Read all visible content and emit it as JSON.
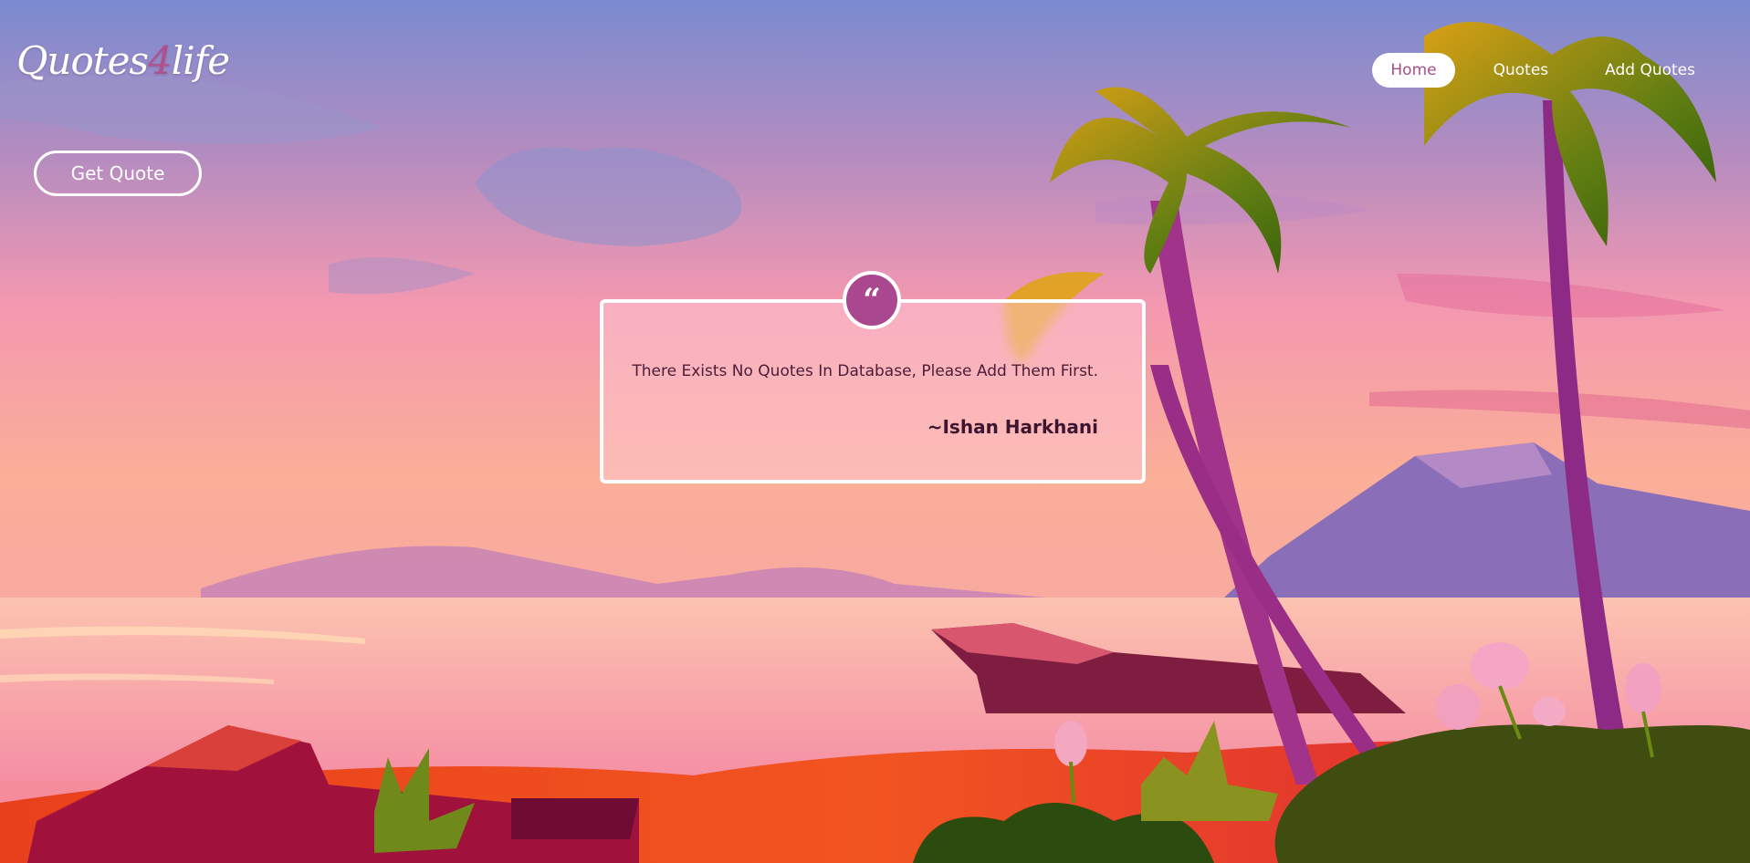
{
  "brand": {
    "part1": "Quotes",
    "part2": "4",
    "part3": "life"
  },
  "nav": {
    "items": [
      {
        "label": "Home"
      },
      {
        "label": "Quotes"
      },
      {
        "label": "Add Quotes"
      }
    ]
  },
  "actions": {
    "get_quote_label": "Get Quote"
  },
  "quote_card": {
    "icon_glyph": "“",
    "text": "There Exists No Quotes In Database, Please Add Them First.",
    "author": "~Ishan Harkhani"
  },
  "colors": {
    "accent": "#a9488e",
    "text_dark": "#4b1c38"
  }
}
